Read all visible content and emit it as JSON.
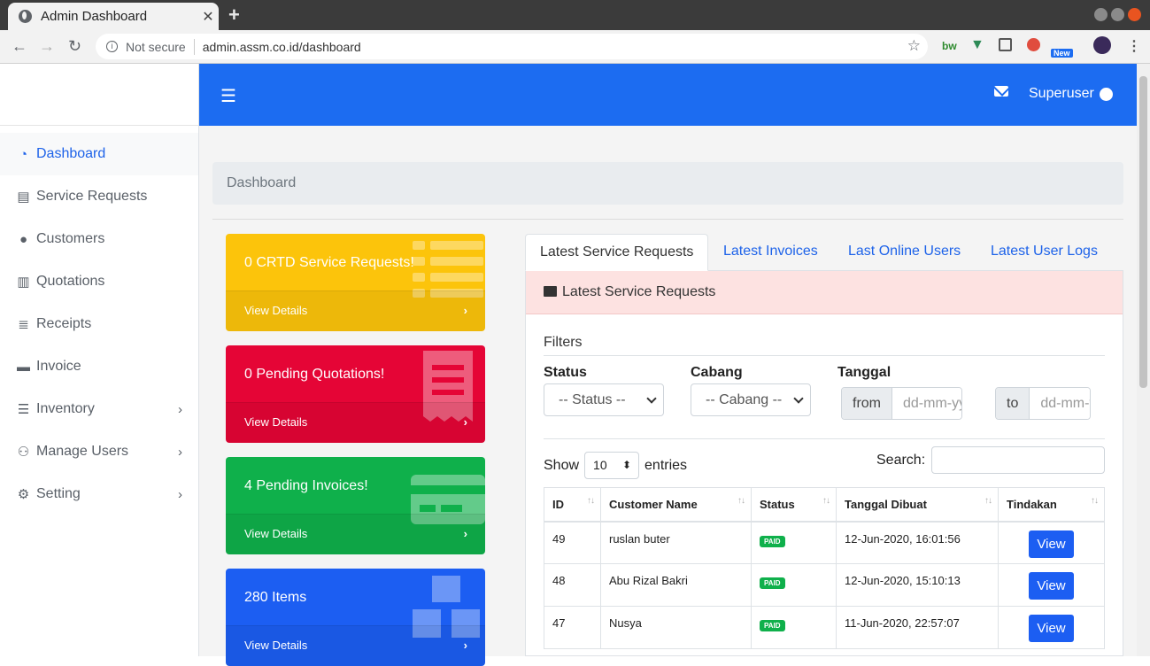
{
  "browser": {
    "tab_title": "Admin Dashboard",
    "tab_close": "✕",
    "new_tab": "+",
    "security": "Not secure",
    "url": "admin.assm.co.id/dashboard",
    "ext_new_badge": "New"
  },
  "topbar": {
    "menu_icon": "☰",
    "user_name": "Superuser"
  },
  "sidebar": {
    "items": [
      {
        "label": "Dashboard",
        "icon": "tachometer-icon",
        "glyph": "◔"
      },
      {
        "label": "Service Requests",
        "icon": "list-icon",
        "glyph": "▤"
      },
      {
        "label": "Customers",
        "icon": "user-circle-icon",
        "glyph": "●"
      },
      {
        "label": "Quotations",
        "icon": "receipt-icon",
        "glyph": "▥"
      },
      {
        "label": "Receipts",
        "icon": "lines-icon",
        "glyph": "≣"
      },
      {
        "label": "Invoice",
        "icon": "credit-card-icon",
        "glyph": "▬"
      },
      {
        "label": "Inventory",
        "icon": "tasks-icon",
        "glyph": "☰"
      },
      {
        "label": "Manage Users",
        "icon": "users-cog-icon",
        "glyph": "⚇"
      },
      {
        "label": "Setting",
        "icon": "gear-icon",
        "glyph": "⚙"
      }
    ]
  },
  "breadcrumb": "Dashboard",
  "cards": [
    {
      "title": "0 CRTD Service Requests!",
      "link": "View Details",
      "color": "#fcc40b"
    },
    {
      "title": "0 Pending Quotations!",
      "link": "View Details",
      "color": "#e50536"
    },
    {
      "title": "4 Pending Invoices!",
      "link": "View Details",
      "color": "#0fb04b"
    },
    {
      "title": "280 Items",
      "link": "View Details",
      "color": "#1c5ef2"
    }
  ],
  "tabs": [
    "Latest Service Requests",
    "Latest Invoices",
    "Last Online Users",
    "Latest User Logs"
  ],
  "panel_title": "Latest Service Requests",
  "filters": {
    "heading": "Filters",
    "status_label": "Status",
    "status_value": "-- Status --",
    "cabang_label": "Cabang",
    "cabang_value": "-- Cabang --",
    "tanggal_label": "Tanggal",
    "from": "from",
    "from_placeholder": "dd-mm-yyyy",
    "to": "to",
    "to_placeholder": "dd-mm-yyyy"
  },
  "table_controls": {
    "show": "Show",
    "entries_value": "10",
    "entries": "entries",
    "search": "Search:"
  },
  "table": {
    "headers": [
      "ID",
      "Customer Name",
      "Status",
      "Tanggal Dibuat",
      "Tindakan"
    ],
    "rows": [
      {
        "id": "49",
        "name": "ruslan buter",
        "status": "PAID",
        "date": "12-Jun-2020, 16:01:56",
        "action": "View"
      },
      {
        "id": "48",
        "name": "Abu Rizal Bakri",
        "status": "PAID",
        "date": "12-Jun-2020, 15:10:13",
        "action": "View"
      },
      {
        "id": "47",
        "name": "Nusya",
        "status": "PAID",
        "date": "11-Jun-2020, 22:57:07",
        "action": "View"
      }
    ]
  }
}
